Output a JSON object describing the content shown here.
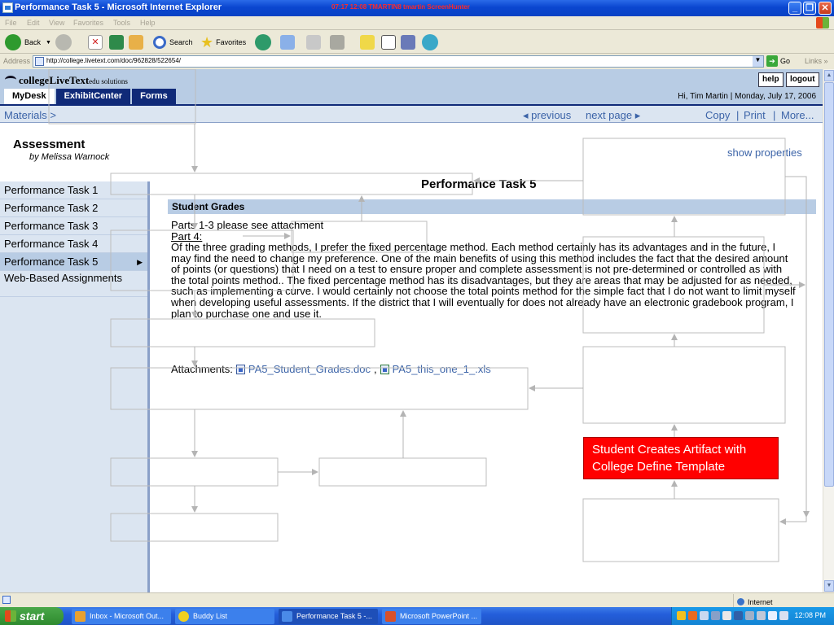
{
  "window": {
    "title": "Performance Task 5 - Microsoft Internet Explorer",
    "capture_label": "07:17 12:08 TMARTIN8 tmartin ScreenHunter"
  },
  "menu": [
    "File",
    "Edit",
    "View",
    "Favorites",
    "Tools",
    "Help"
  ],
  "toolbar": {
    "back": "Back",
    "search": "Search",
    "favorites": "Favorites"
  },
  "address": {
    "label": "Address",
    "url": "http://college.livetext.com/doc/962828/522654/",
    "go": "Go",
    "links": "Links"
  },
  "site": {
    "logo_main": "collegeLiveText",
    "logo_sub": "edu solutions",
    "help": "help",
    "logout": "logout",
    "tabs": [
      "MyDesk",
      "ExhibitCenter",
      "Forms"
    ],
    "greeting": "Hi, Tim Martin | Monday, July 17, 2006"
  },
  "subnav": {
    "breadcrumb": "Materials >",
    "previous": "◂ previous",
    "next": "next page ▸",
    "copy": "Copy",
    "print": "Print",
    "more": "More...",
    "sep": "|"
  },
  "doc": {
    "title": "Assessment",
    "author": "by Melissa Warnock",
    "show_properties": "show properties",
    "task_title": "Performance Task 5",
    "section": "Student Grades",
    "line1": "Parts 1-3 please see attachment",
    "line2": "Part 4:",
    "body": "Of the three grading methods, I prefer the fixed percentage method. Each method certainly has its advantages and in the future, I may find the need to change my preference. One of the main benefits of using this method includes the fact that the desired amount of points (or questions) that I need on a test to ensure proper and complete assessment is not pre-determined or controlled as with the total points method.. The fixed percentage method has its disadvantages, but they are areas that may be adjusted for as needed, such as implementing a curve. I would certainly not choose the total points method for the simple fact that I do not want to limit myself when developing useful assessments. If the district that I will eventually for does not already have an electronic gradebook program, I plan to purchase one and use it.",
    "attachments_label": "Attachments:",
    "attachment1": "PA5_Student_Grades.doc",
    "attachment_sep": ",",
    "attachment2": "PA5_this_one_1_.xls"
  },
  "sidebar": [
    "Performance Task 1",
    "Performance Task 2",
    "Performance Task 3",
    "Performance Task 4",
    "Performance Task 5",
    "Web-Based Assignments"
  ],
  "callout": "Student Creates Artifact with College Define Template",
  "status": {
    "zone": "Internet"
  },
  "taskbar": {
    "start": "start",
    "items": [
      "Inbox - Microsoft Out...",
      "Buddy List",
      "Performance Task 5 -...",
      "Microsoft PowerPoint ..."
    ],
    "clock": "12:08 PM"
  },
  "colors": {
    "accent": "#102a78",
    "panel": "#b8cce4",
    "callout": "#ff0000",
    "link": "#3c64a8"
  }
}
